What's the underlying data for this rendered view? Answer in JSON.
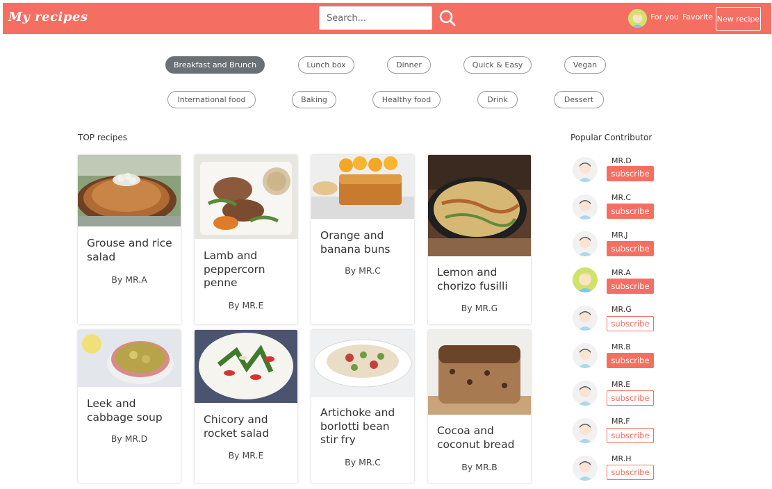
{
  "header": {
    "logo": "My recipes",
    "search_placeholder": "Search...",
    "nav_for_you": "For you",
    "nav_favorite": "Favorite",
    "new_recipe_label": "New recipe"
  },
  "categories": [
    {
      "label": "Breakfast and Brunch",
      "active": true
    },
    {
      "label": "Lunch box",
      "active": false
    },
    {
      "label": "Dinner",
      "active": false
    },
    {
      "label": "Quick & Easy",
      "active": false
    },
    {
      "label": "Vegan",
      "active": false
    },
    {
      "label": "International food",
      "active": false
    },
    {
      "label": "Baking",
      "active": false
    },
    {
      "label": "Healthy food",
      "active": false
    },
    {
      "label": "Drink",
      "active": false
    },
    {
      "label": "Dessert",
      "active": false
    }
  ],
  "top_recipes": {
    "title": "TOP recipes",
    "cards": [
      {
        "title": "Grouse and rice salad",
        "author": "By MR.A"
      },
      {
        "title": "Lamb and peppercorn penne",
        "author": "By MR.E"
      },
      {
        "title": "Orange and banana buns",
        "author": "By MR.C"
      },
      {
        "title": "Lemon and chorizo fusilli",
        "author": "By MR.G"
      },
      {
        "title": "Leek and cabbage soup",
        "author": "By MR.D"
      },
      {
        "title": "Chicory and rocket salad",
        "author": "By MR.E"
      },
      {
        "title": "Artichoke and borlotti bean stir fry",
        "author": "By MR.C"
      },
      {
        "title": "Cocoa and coconut bread",
        "author": "By MR.B"
      }
    ]
  },
  "contributors": {
    "title": "Popular Contributor",
    "subscribe_label": "subscribe",
    "items": [
      {
        "name": "MR.D",
        "subscribed": true
      },
      {
        "name": "MR.C",
        "subscribed": true
      },
      {
        "name": "MR.J",
        "subscribed": true
      },
      {
        "name": "MR.A",
        "subscribed": true
      },
      {
        "name": "MR.G",
        "subscribed": false
      },
      {
        "name": "MR.B",
        "subscribed": true
      },
      {
        "name": "MR.E",
        "subscribed": false
      },
      {
        "name": "MR.F",
        "subscribed": false
      },
      {
        "name": "MR.H",
        "subscribed": false
      }
    ]
  },
  "colors": {
    "brand": "#f46f62",
    "chip_active": "#6a7074"
  }
}
